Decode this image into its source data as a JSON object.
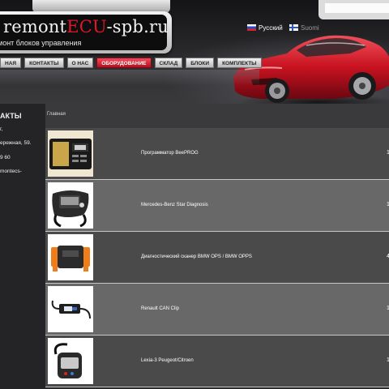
{
  "header": {
    "logo": {
      "title_part1": "remont",
      "title_part2": "ECU",
      "title_part3": "-spb.ru",
      "subtitle": "ремонт блоков управления"
    },
    "search": {
      "value": "",
      "placeholder": ""
    },
    "languages": [
      {
        "label": "Русский",
        "flag": "flag-ru-icon"
      },
      {
        "label": "Suomi",
        "flag": "flag-fi-icon"
      }
    ],
    "colors": {
      "accent": "#e0152a",
      "nav_active": "#d01a2c"
    }
  },
  "nav": {
    "items": [
      {
        "label": "НАЯ",
        "active": false
      },
      {
        "label": "КОНТАКТЫ",
        "active": false
      },
      {
        "label": "О НАС",
        "active": false
      },
      {
        "label": "ОБОРУДОВАНИЕ",
        "active": true
      },
      {
        "label": "СКЛАД",
        "active": false
      },
      {
        "label": "БЛОКИ",
        "active": false
      },
      {
        "label": "КОМПЛЕКТЫ",
        "active": false
      }
    ]
  },
  "sidebar": {
    "heading": "АКТЫ",
    "lines": [
      "г,",
      "ережная, 59.",
      "9 60",
      "montecs-"
    ]
  },
  "breadcrumb": "Главная",
  "products": [
    {
      "name": "Программатор BeePROG",
      "num": "1",
      "icon": "programmer-device-icon"
    },
    {
      "name": "Mercedes-Benz Star Diagnosis",
      "num": "1",
      "icon": "diagnostic-case-icon"
    },
    {
      "name": "Диагностический сканер BMW OPS / BMW OPPS",
      "num": "4",
      "icon": "bmw-scanner-icon"
    },
    {
      "name": "Renault CAN Clip",
      "num": "1",
      "icon": "can-clip-icon"
    },
    {
      "name": "Lexia-3 Peugeot/Citroen",
      "num": "1",
      "icon": "lexia-cable-icon"
    }
  ]
}
